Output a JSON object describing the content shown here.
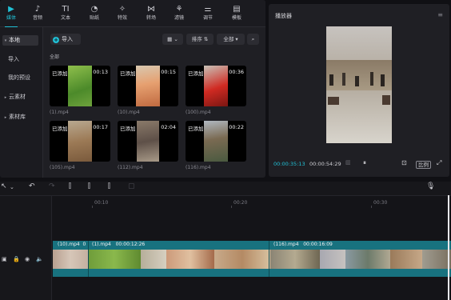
{
  "toolbar": {
    "items": [
      {
        "label": "媒体",
        "icon": "media-icon",
        "glyph": "▶"
      },
      {
        "label": "音频",
        "icon": "audio-icon",
        "glyph": "♪"
      },
      {
        "label": "文本",
        "icon": "text-icon",
        "glyph": "TI"
      },
      {
        "label": "贴纸",
        "icon": "sticker-icon",
        "glyph": "◔"
      },
      {
        "label": "特效",
        "icon": "effects-icon",
        "glyph": "✧"
      },
      {
        "label": "转场",
        "icon": "transition-icon",
        "glyph": "⋈"
      },
      {
        "label": "滤镜",
        "icon": "filter-icon",
        "glyph": "⚘"
      },
      {
        "label": "调节",
        "icon": "adjust-icon",
        "glyph": "⚌"
      },
      {
        "label": "模板",
        "icon": "template-icon",
        "glyph": "▤"
      }
    ]
  },
  "sidebar": {
    "items": [
      {
        "label": "本地",
        "arrow": "▾"
      },
      {
        "label": "导入",
        "arrow": ""
      },
      {
        "label": "我的预设",
        "arrow": ""
      },
      {
        "label": "云素材",
        "arrow": "▸"
      },
      {
        "label": "素材库",
        "arrow": "▸"
      }
    ]
  },
  "media": {
    "import_label": "导入",
    "view_glyph": "▦ ⌄",
    "sort_label": "排序",
    "filter_label": "全部",
    "search_glyph": "⌕",
    "section_label": "全部",
    "cards": [
      {
        "added": "已添加",
        "duration": "00:13",
        "filename": "(1).mp4"
      },
      {
        "added": "已添加",
        "duration": "00:15",
        "filename": "(10).mp4"
      },
      {
        "added": "已添加",
        "duration": "00:36",
        "filename": "(100).mp4"
      },
      {
        "added": "已添加",
        "duration": "00:17",
        "filename": "(105).mp4"
      },
      {
        "added": "已添加",
        "duration": "02:04",
        "filename": "(112).mp4"
      },
      {
        "added": "已添加",
        "duration": "00:22",
        "filename": "(116).mp4"
      }
    ]
  },
  "player": {
    "title": "播放器",
    "menu_glyph": "≡",
    "current_time": "00:00:35:13",
    "total_time": "00:00:54:29",
    "play_glyph": "⏸",
    "ratio_label": "比例"
  },
  "timeline": {
    "ticks": [
      "00:10",
      "00:20",
      "00:30"
    ],
    "clips": [
      {
        "label": "(10).mp4  0"
      },
      {
        "label": "(1).mp4   00:00:12:26"
      },
      {
        "label": "(116).mp4   00:00:16:09"
      }
    ]
  },
  "colors": {
    "accent": "#21c1d6",
    "clip": "#18727f",
    "panel": "#1f1f24",
    "background": "#101014"
  }
}
